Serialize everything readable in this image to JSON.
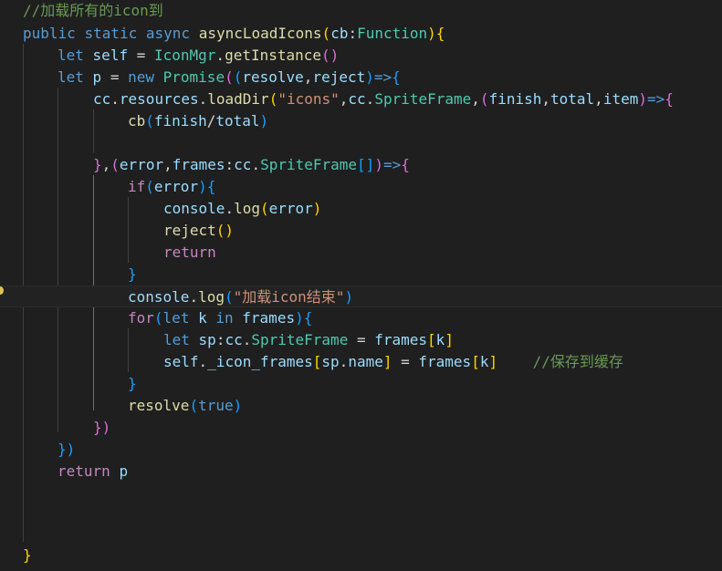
{
  "editor": {
    "lines": [
      [
        {
          "t": "//加载所有的icon到",
          "c": "cm"
        }
      ],
      [
        {
          "t": "public",
          "c": "kw"
        },
        {
          "t": " ",
          "c": "tx"
        },
        {
          "t": "static",
          "c": "kw"
        },
        {
          "t": " ",
          "c": "tx"
        },
        {
          "t": "async",
          "c": "kw"
        },
        {
          "t": " ",
          "c": "tx"
        },
        {
          "t": "asyncLoadIcons",
          "c": "fn"
        },
        {
          "t": "(",
          "c": "p1"
        },
        {
          "t": "cb",
          "c": "vr"
        },
        {
          "t": ":",
          "c": "tx"
        },
        {
          "t": "Function",
          "c": "ty"
        },
        {
          "t": ")",
          "c": "p1"
        },
        {
          "t": "{",
          "c": "p1"
        }
      ],
      [
        {
          "t": "let",
          "c": "kw"
        },
        {
          "t": " ",
          "c": "tx"
        },
        {
          "t": "self",
          "c": "vr"
        },
        {
          "t": " = ",
          "c": "tx"
        },
        {
          "t": "IconMgr",
          "c": "ty"
        },
        {
          "t": ".",
          "c": "tx"
        },
        {
          "t": "getInstance",
          "c": "fn"
        },
        {
          "t": "()",
          "c": "p2"
        }
      ],
      [
        {
          "t": "let",
          "c": "kw"
        },
        {
          "t": " ",
          "c": "tx"
        },
        {
          "t": "p",
          "c": "vr"
        },
        {
          "t": " = ",
          "c": "tx"
        },
        {
          "t": "new",
          "c": "kw"
        },
        {
          "t": " ",
          "c": "tx"
        },
        {
          "t": "Promise",
          "c": "ty"
        },
        {
          "t": "(",
          "c": "p2"
        },
        {
          "t": "(",
          "c": "p3"
        },
        {
          "t": "resolve",
          "c": "vr"
        },
        {
          "t": ",",
          "c": "tx"
        },
        {
          "t": "reject",
          "c": "vr"
        },
        {
          "t": ")",
          "c": "p3"
        },
        {
          "t": "=>",
          "c": "kw"
        },
        {
          "t": "{",
          "c": "p3"
        }
      ],
      [
        {
          "t": "cc",
          "c": "vr"
        },
        {
          "t": ".",
          "c": "tx"
        },
        {
          "t": "resources",
          "c": "vr"
        },
        {
          "t": ".",
          "c": "tx"
        },
        {
          "t": "loadDir",
          "c": "fn"
        },
        {
          "t": "(",
          "c": "p1"
        },
        {
          "t": "\"icons\"",
          "c": "st"
        },
        {
          "t": ",",
          "c": "tx"
        },
        {
          "t": "cc",
          "c": "vr"
        },
        {
          "t": ".",
          "c": "tx"
        },
        {
          "t": "SpriteFrame",
          "c": "ty"
        },
        {
          "t": ",",
          "c": "tx"
        },
        {
          "t": "(",
          "c": "p2"
        },
        {
          "t": "finish",
          "c": "vr"
        },
        {
          "t": ",",
          "c": "tx"
        },
        {
          "t": "total",
          "c": "vr"
        },
        {
          "t": ",",
          "c": "tx"
        },
        {
          "t": "item",
          "c": "vr"
        },
        {
          "t": ")",
          "c": "p2"
        },
        {
          "t": "=>",
          "c": "kw"
        },
        {
          "t": "{",
          "c": "p2"
        }
      ],
      [
        {
          "t": "cb",
          "c": "fn"
        },
        {
          "t": "(",
          "c": "p3"
        },
        {
          "t": "finish",
          "c": "vr"
        },
        {
          "t": "/",
          "c": "tx"
        },
        {
          "t": "total",
          "c": "vr"
        },
        {
          "t": ")",
          "c": "p3"
        }
      ],
      [],
      [
        {
          "t": "}",
          "c": "p2"
        },
        {
          "t": ",",
          "c": "tx"
        },
        {
          "t": "(",
          "c": "p2"
        },
        {
          "t": "error",
          "c": "vr"
        },
        {
          "t": ",",
          "c": "tx"
        },
        {
          "t": "frames",
          "c": "vr"
        },
        {
          "t": ":",
          "c": "tx"
        },
        {
          "t": "cc",
          "c": "vr"
        },
        {
          "t": ".",
          "c": "tx"
        },
        {
          "t": "SpriteFrame",
          "c": "ty"
        },
        {
          "t": "[]",
          "c": "p3"
        },
        {
          "t": ")",
          "c": "p2"
        },
        {
          "t": "=>",
          "c": "kw"
        },
        {
          "t": "{",
          "c": "p2"
        }
      ],
      [
        {
          "t": "if",
          "c": "kc"
        },
        {
          "t": "(",
          "c": "p3"
        },
        {
          "t": "error",
          "c": "vr"
        },
        {
          "t": ")",
          "c": "p3"
        },
        {
          "t": "{",
          "c": "p3"
        }
      ],
      [
        {
          "t": "console",
          "c": "vr"
        },
        {
          "t": ".",
          "c": "tx"
        },
        {
          "t": "log",
          "c": "fn"
        },
        {
          "t": "(",
          "c": "p1"
        },
        {
          "t": "error",
          "c": "vr"
        },
        {
          "t": ")",
          "c": "p1"
        }
      ],
      [
        {
          "t": "reject",
          "c": "fn"
        },
        {
          "t": "()",
          "c": "p1"
        }
      ],
      [
        {
          "t": "return",
          "c": "kc"
        }
      ],
      [
        {
          "t": "}",
          "c": "p3"
        }
      ],
      [
        {
          "t": "console",
          "c": "vr"
        },
        {
          "t": ".",
          "c": "tx"
        },
        {
          "t": "log",
          "c": "fn"
        },
        {
          "t": "(",
          "c": "p3"
        },
        {
          "t": "\"加载icon结束\"",
          "c": "st"
        },
        {
          "t": ")",
          "c": "p3"
        }
      ],
      [
        {
          "t": "for",
          "c": "kc"
        },
        {
          "t": "(",
          "c": "p3"
        },
        {
          "t": "let",
          "c": "kw"
        },
        {
          "t": " ",
          "c": "tx"
        },
        {
          "t": "k",
          "c": "vr"
        },
        {
          "t": " ",
          "c": "tx"
        },
        {
          "t": "in",
          "c": "kw"
        },
        {
          "t": " ",
          "c": "tx"
        },
        {
          "t": "frames",
          "c": "vr"
        },
        {
          "t": ")",
          "c": "p3"
        },
        {
          "t": "{",
          "c": "p3"
        }
      ],
      [
        {
          "t": "let",
          "c": "kw"
        },
        {
          "t": " ",
          "c": "tx"
        },
        {
          "t": "sp",
          "c": "vr"
        },
        {
          "t": ":",
          "c": "tx"
        },
        {
          "t": "cc",
          "c": "vr"
        },
        {
          "t": ".",
          "c": "tx"
        },
        {
          "t": "SpriteFrame",
          "c": "ty"
        },
        {
          "t": " = ",
          "c": "tx"
        },
        {
          "t": "frames",
          "c": "vr"
        },
        {
          "t": "[",
          "c": "p1"
        },
        {
          "t": "k",
          "c": "vr"
        },
        {
          "t": "]",
          "c": "p1"
        }
      ],
      [
        {
          "t": "self",
          "c": "vr"
        },
        {
          "t": ".",
          "c": "tx"
        },
        {
          "t": "_icon_frames",
          "c": "vr"
        },
        {
          "t": "[",
          "c": "p1"
        },
        {
          "t": "sp",
          "c": "vr"
        },
        {
          "t": ".",
          "c": "tx"
        },
        {
          "t": "name",
          "c": "vr"
        },
        {
          "t": "]",
          "c": "p1"
        },
        {
          "t": " = ",
          "c": "tx"
        },
        {
          "t": "frames",
          "c": "vr"
        },
        {
          "t": "[",
          "c": "p1"
        },
        {
          "t": "k",
          "c": "vr"
        },
        {
          "t": "]",
          "c": "p1"
        },
        {
          "t": "    ",
          "c": "tx"
        },
        {
          "t": "//保存到缓存",
          "c": "cm"
        }
      ],
      [
        {
          "t": "}",
          "c": "p3"
        }
      ],
      [
        {
          "t": "resolve",
          "c": "fn"
        },
        {
          "t": "(",
          "c": "p3"
        },
        {
          "t": "true",
          "c": "kw"
        },
        {
          "t": ")",
          "c": "p3"
        }
      ],
      [
        {
          "t": "})",
          "c": "p2"
        }
      ],
      [
        {
          "t": "})",
          "c": "p3"
        }
      ],
      [
        {
          "t": "return",
          "c": "kc"
        },
        {
          "t": " ",
          "c": "tx"
        },
        {
          "t": "p",
          "c": "vr"
        }
      ],
      [],
      [],
      [],
      [
        {
          "t": "}",
          "c": "p1"
        }
      ]
    ]
  },
  "colors": {
    "background": "#1f1f1f",
    "comment": "#6a9955",
    "keyword": "#569cd6",
    "control": "#c586c0",
    "function": "#dcdcaa",
    "type": "#4ec9b0",
    "variable": "#9cdcfe",
    "string": "#ce9178",
    "lightbulb": "#e2c04f"
  }
}
